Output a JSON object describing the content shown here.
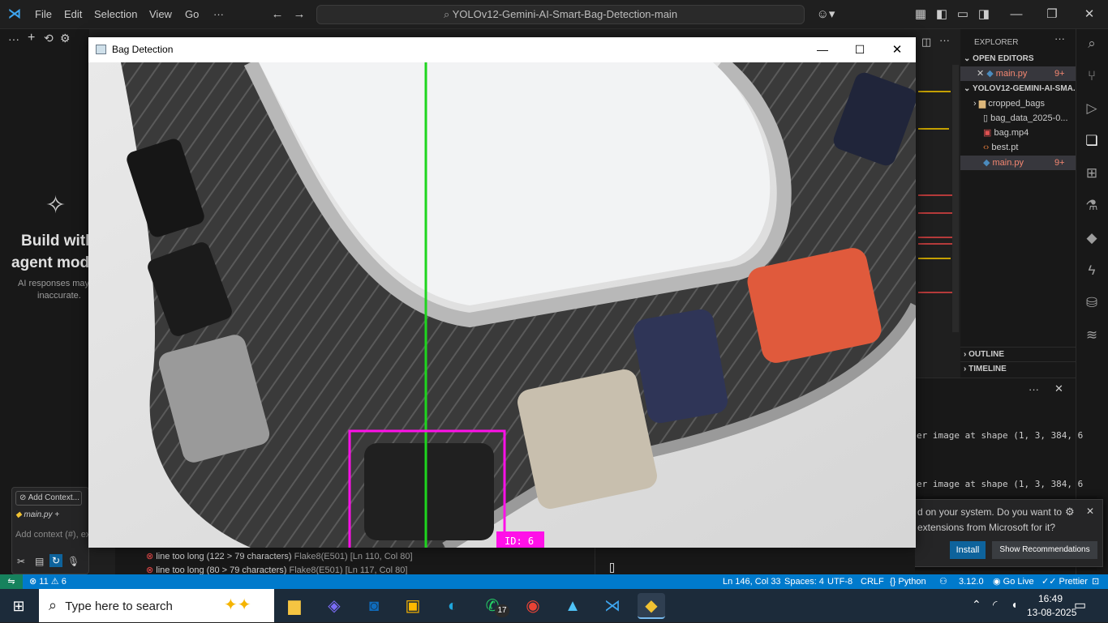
{
  "vscode": {
    "menu": [
      "File",
      "Edit",
      "Selection",
      "View",
      "Go",
      "···"
    ],
    "search_text": "YOLOv12-Gemini-AI-Smart-Bag-Detection-main",
    "chat": {
      "heading_line1": "Build with",
      "heading_line2": "agent mod",
      "note_line1": "AI responses may",
      "note_line2": "inaccurate.",
      "add_context": "Add Context...",
      "file_chip": "main.py",
      "input_placeholder": "Add context (#), ex"
    },
    "explorer": {
      "title": "EXPLORER",
      "open_editors_label": "OPEN EDITORS",
      "open_editor_file": "main.py",
      "open_editor_badge": "9+",
      "project_label": "YOLOV12-GEMINI-AI-SMA...",
      "files": [
        {
          "name": "cropped_bags",
          "icon": "folder-icon"
        },
        {
          "name": "bag_data_2025-0...",
          "icon": "file-icon"
        },
        {
          "name": "bag.mp4",
          "icon": "video-file-icon"
        },
        {
          "name": "best.pt",
          "icon": "code-file-icon"
        },
        {
          "name": "main.py",
          "icon": "python-icon",
          "badge": "9+"
        }
      ],
      "outline_label": "OUTLINE",
      "timeline_label": "TIMELINE"
    },
    "terminal_lines": [
      "er image at shape (1, 3, 384, 6",
      "er image at shape (1, 3, 384, 6"
    ],
    "notification": {
      "line1": "d on your system. Do you want to",
      "line2": "extensions from Microsoft for it?",
      "install": "Install",
      "show_recs": "Show Recommendations"
    },
    "problems": [
      {
        "text": "line too long (122 > 79 characters)",
        "source": "Flake8(E501)",
        "pos": "[Ln 110, Col 80]"
      },
      {
        "text": "line too long (80 > 79 characters)",
        "source": "Flake8(E501)",
        "pos": "[Ln 117, Col 80]"
      }
    ],
    "statusbar": {
      "errors": "11",
      "warnings": "6",
      "position": "Ln 146, Col 33",
      "spaces": "Spaces: 4",
      "encoding": "UTF-8",
      "eol": "CRLF",
      "language": "Python",
      "version": "3.12.0",
      "golive": "Go Live",
      "prettier": "Prettier"
    }
  },
  "bag_window": {
    "title": "Bag Detection",
    "detection_label": "ID: 6",
    "line_color": "#1ed51e",
    "box_color": "#ff10e8"
  },
  "taskbar": {
    "search_placeholder": "Type here to search",
    "whatsapp_badge": "17",
    "time": "16:49",
    "date": "13-08-2025"
  }
}
